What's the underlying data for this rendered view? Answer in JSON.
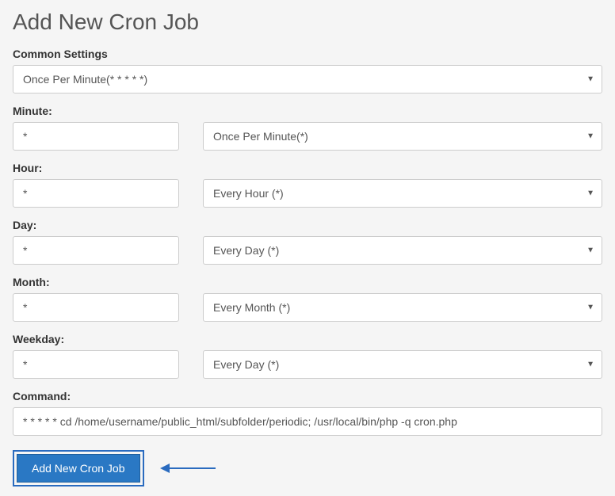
{
  "title": "Add New Cron Job",
  "commonSettings": {
    "label": "Common Settings",
    "selected": "Once Per Minute(* * * * *)"
  },
  "minute": {
    "label": "Minute:",
    "value": "*",
    "selected": "Once Per Minute(*)"
  },
  "hour": {
    "label": "Hour:",
    "value": "*",
    "selected": "Every Hour (*)"
  },
  "day": {
    "label": "Day:",
    "value": "*",
    "selected": "Every Day (*)"
  },
  "month": {
    "label": "Month:",
    "value": "*",
    "selected": "Every Month (*)"
  },
  "weekday": {
    "label": "Weekday:",
    "value": "*",
    "selected": "Every Day (*)"
  },
  "command": {
    "label": "Command:",
    "value": "* * * * * cd /home/username/public_html/subfolder/periodic; /usr/local/bin/php -q cron.php"
  },
  "submitLabel": "Add New Cron Job"
}
